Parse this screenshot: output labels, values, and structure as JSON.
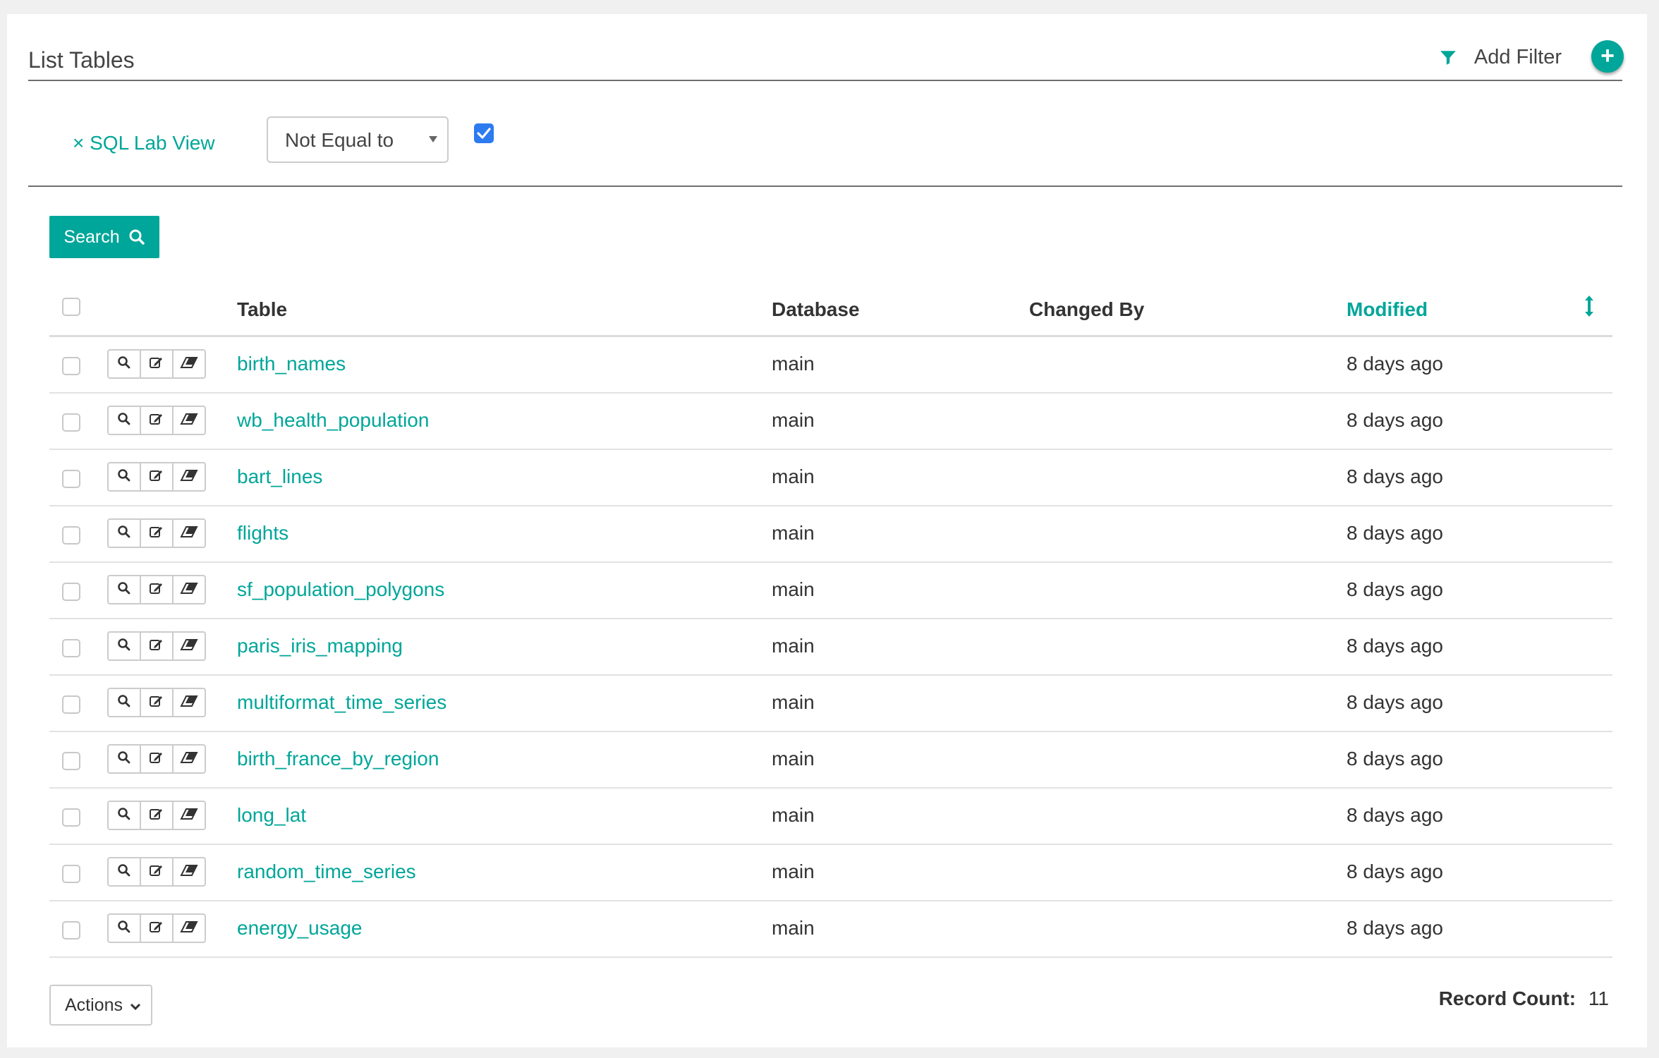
{
  "header": {
    "title": "List Tables",
    "add_filter_label": "Add Filter",
    "add_button_symbol": "+"
  },
  "filter": {
    "remove_label": "× SQL Lab View",
    "operator": "Not Equal to",
    "checked": true
  },
  "search_label": "Search",
  "table": {
    "columns": {
      "table": "Table",
      "database": "Database",
      "changed_by": "Changed By",
      "modified": "Modified"
    },
    "sorted_column": "Modified",
    "rows": [
      {
        "table": "birth_names",
        "database": "main",
        "changed_by": "",
        "modified": "8 days ago"
      },
      {
        "table": "wb_health_population",
        "database": "main",
        "changed_by": "",
        "modified": "8 days ago"
      },
      {
        "table": "bart_lines",
        "database": "main",
        "changed_by": "",
        "modified": "8 days ago"
      },
      {
        "table": "flights",
        "database": "main",
        "changed_by": "",
        "modified": "8 days ago"
      },
      {
        "table": "sf_population_polygons",
        "database": "main",
        "changed_by": "",
        "modified": "8 days ago"
      },
      {
        "table": "paris_iris_mapping",
        "database": "main",
        "changed_by": "",
        "modified": "8 days ago"
      },
      {
        "table": "multiformat_time_series",
        "database": "main",
        "changed_by": "",
        "modified": "8 days ago"
      },
      {
        "table": "birth_france_by_region",
        "database": "main",
        "changed_by": "",
        "modified": "8 days ago"
      },
      {
        "table": "long_lat",
        "database": "main",
        "changed_by": "",
        "modified": "8 days ago"
      },
      {
        "table": "random_time_series",
        "database": "main",
        "changed_by": "",
        "modified": "8 days ago"
      },
      {
        "table": "energy_usage",
        "database": "main",
        "changed_by": "",
        "modified": "8 days ago"
      }
    ],
    "row_action_icons": [
      "search-icon",
      "edit-icon",
      "eraser-icon"
    ]
  },
  "footer": {
    "actions_label": "Actions",
    "record_count_label": "Record Count:",
    "record_count_value": "11"
  },
  "colors": {
    "accent": "#00a699",
    "checkbox_checked": "#2d7bf0"
  }
}
